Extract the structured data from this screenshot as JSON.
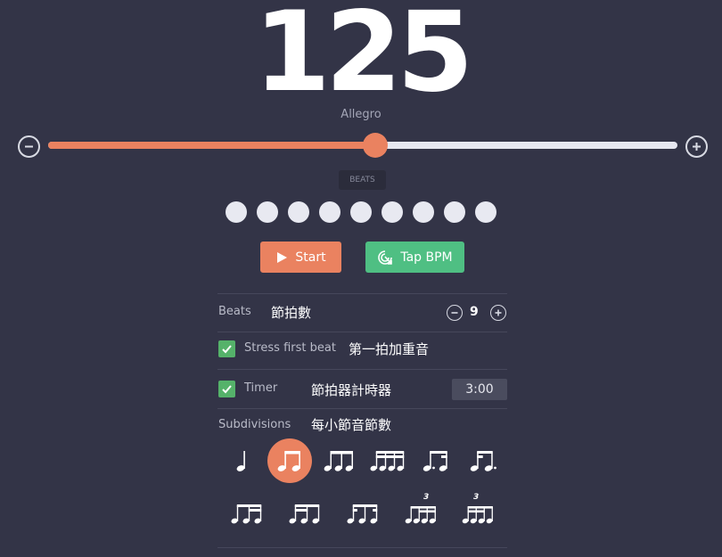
{
  "tempo": {
    "bpm": "125",
    "marking": "Allegro",
    "slider_fraction": 0.52
  },
  "beats_tag": "BEATS",
  "beat_dots_count": 9,
  "buttons": {
    "start_label": "Start",
    "tap_label": "Tap BPM"
  },
  "settings": {
    "beats_label": "Beats",
    "beats_note": "節拍數",
    "beats_value": "9",
    "stress_label": "Stress first beat",
    "stress_note": "第一拍加重音",
    "stress_checked": true,
    "timer_label": "Timer",
    "timer_note": "節拍器計時器",
    "timer_checked": true,
    "timer_value": "3:00",
    "subdivisions_label": "Subdivisions",
    "subdivisions_note": "每小節音節數"
  },
  "subdivisions": {
    "active_index": 1,
    "triplet_mark": "3",
    "row1": [
      "quarter-note-icon",
      "eighth-pair-icon",
      "triplet-eighths-icon",
      "sixteenths-icon",
      "dotted-eighth-sixteenth-icon",
      "sixteenth-dotted-eighth-icon"
    ],
    "row2": [
      "eighth-two-sixteenths-icon",
      "two-sixteenths-eighth-icon",
      "sixteenth-eighth-sixteenth-icon",
      "sixteenth-triplet-icon",
      "sixteenth-sextuplet-icon"
    ]
  },
  "colors": {
    "background": "#333447",
    "accent": "#ea8260",
    "green": "#4fbf83",
    "track": "#e6e7f0"
  }
}
